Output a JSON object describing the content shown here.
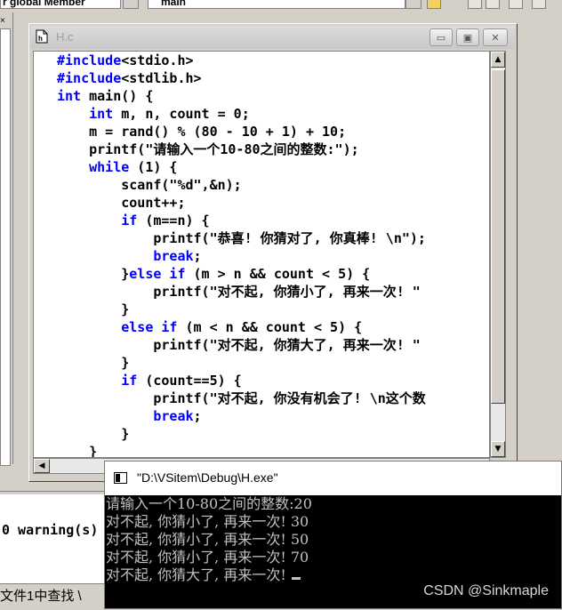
{
  "toolbar": {
    "scope_combo": "r global Member",
    "function_combo": "main"
  },
  "editor": {
    "title": "H.c",
    "code_lines": [
      [
        {
          "t": "#include",
          "k": true
        },
        {
          "t": "<stdio.h>"
        }
      ],
      [
        {
          "t": "#include",
          "k": true
        },
        {
          "t": "<stdlib.h>"
        }
      ],
      [
        {
          "t": "int",
          "k": true
        },
        {
          "t": " main() {"
        }
      ],
      [
        {
          "t": "    "
        },
        {
          "t": "int",
          "k": true
        },
        {
          "t": " m, n, count = 0;"
        }
      ],
      [
        {
          "t": "    m = rand() % (80 - 10 + 1) + 10;"
        }
      ],
      [
        {
          "t": "    printf(\"请输入一个10-80之间的整数:\");"
        }
      ],
      [
        {
          "t": "    "
        },
        {
          "t": "while",
          "k": true
        },
        {
          "t": " (1) {"
        }
      ],
      [
        {
          "t": "        scanf(\"%d\",&n);"
        }
      ],
      [
        {
          "t": "        count++;"
        }
      ],
      [
        {
          "t": "        "
        },
        {
          "t": "if",
          "k": true
        },
        {
          "t": " (m==n) {"
        }
      ],
      [
        {
          "t": "            printf(\"恭喜! 你猜对了, 你真棒! \\n\");"
        }
      ],
      [
        {
          "t": "            "
        },
        {
          "t": "break",
          "k": true
        },
        {
          "t": ";"
        }
      ],
      [
        {
          "t": "        }"
        },
        {
          "t": "else if",
          "k": true
        },
        {
          "t": " (m > n && count < 5) {"
        }
      ],
      [
        {
          "t": "            printf(\"对不起, 你猜小了, 再来一次! \""
        }
      ],
      [
        {
          "t": "        }"
        }
      ],
      [
        {
          "t": "        "
        },
        {
          "t": "else if",
          "k": true
        },
        {
          "t": " (m < n && count < 5) {"
        }
      ],
      [
        {
          "t": "            printf(\"对不起, 你猜大了, 再来一次! \""
        }
      ],
      [
        {
          "t": "        }"
        }
      ],
      [
        {
          "t": "        "
        },
        {
          "t": "if",
          "k": true
        },
        {
          "t": " (count==5) {"
        }
      ],
      [
        {
          "t": "            printf(\"对不起, 你没有机会了! \\n这个数"
        }
      ],
      [
        {
          "t": "            "
        },
        {
          "t": "break",
          "k": true
        },
        {
          "t": ";"
        }
      ],
      [
        {
          "t": "        }"
        }
      ],
      [
        {
          "t": "    }"
        }
      ]
    ]
  },
  "output": {
    "warning_text": "0 warning(s)",
    "tab_label": "文件1中查找 \\"
  },
  "console": {
    "title": "\"D:\\VSitem\\Debug\\H.exe\"",
    "lines": [
      "请输入一个10-80之间的整数:20",
      "对不起, 你猜小了, 再来一次! 30",
      "对不起, 你猜小了, 再来一次! 50",
      "对不起, 你猜小了, 再来一次! 70",
      "对不起, 你猜大了, 再来一次!"
    ]
  },
  "watermark": "CSDN @Sinkmaple",
  "colors": {
    "keyword": "#0000ff",
    "console_bg": "#000000",
    "console_text": "#c0c0c0"
  }
}
